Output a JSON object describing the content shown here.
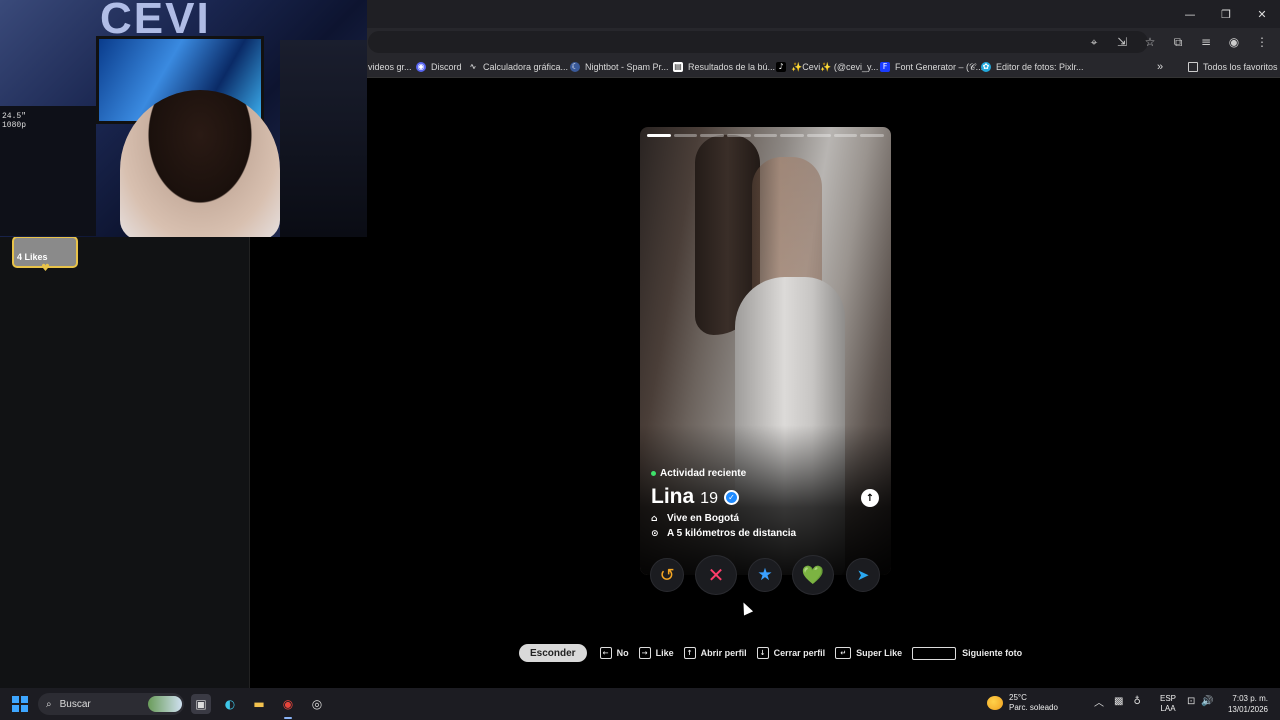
{
  "window": {
    "controls": [
      "—",
      "❐",
      "✕"
    ]
  },
  "toolbar": {
    "icons": [
      "location-icon",
      "install-icon",
      "star-icon",
      "extensions-icon",
      "media-icon",
      "profile-icon",
      "menu-icon"
    ]
  },
  "bookmarks": [
    {
      "label": "videos gr...",
      "icon": "video-icon",
      "color": "#27272c"
    },
    {
      "label": "Discord",
      "icon": "discord-icon",
      "color": "#5865f2"
    },
    {
      "label": "Calculadora gráfica...",
      "icon": "desmos-icon",
      "color": "#2d2d2d"
    },
    {
      "label": "Nightbot - Spam Pr...",
      "icon": "nightbot-icon",
      "color": "#3a5a9a"
    },
    {
      "label": "Resultados de la bú...",
      "icon": "doc-icon",
      "color": "#ffffff"
    },
    {
      "label": "✨Cevi✨ (@cevi_y...",
      "icon": "tiktok-icon",
      "color": "#000000"
    },
    {
      "label": "Font Generator – (𝒞...",
      "icon": "font-icon",
      "color": "#1a3cff"
    },
    {
      "label": "Editor de fotos: Pixlr...",
      "icon": "pixlr-icon",
      "color": "#22aadd"
    }
  ],
  "bookmarks_more": "»",
  "bookmarks_all": "Todos los favoritos",
  "webcam": {
    "logo": "CEVI",
    "monitor_text": "24.5\"\n1080p"
  },
  "sidebar": {
    "likes_label": "4 Likes"
  },
  "profile": {
    "photo_count": 9,
    "current_photo": 1,
    "activity": "Actividad reciente",
    "name": "Lina",
    "age": "19",
    "lives_in": "Vive en Bogotá",
    "distance": "A 5 kilómetros de distancia"
  },
  "actions": {
    "rewind": "↺",
    "nope": "✕",
    "super_like": "★",
    "like": "💚",
    "boost": "➤",
    "colors": {
      "rewind": "#f5a623",
      "nope": "#ff3d6b",
      "super_like": "#3aa0ff",
      "like": "#4be07a",
      "boost": "#2aa8f0"
    }
  },
  "hints": {
    "hide_label": "Esconder",
    "no": "No",
    "like": "Like",
    "open_profile": "Abrir perfil",
    "close_profile": "Cerrar perfil",
    "super_like": "Super Like",
    "next_photo": "Siguiente foto"
  },
  "taskbar": {
    "search_placeholder": "Buscar",
    "weather_temp": "25°C",
    "weather_desc": "Parc. soleado",
    "lang_line1": "ESP",
    "lang_line2": "LAA",
    "time": "7:03 p. m.",
    "date": "13/01/2026"
  }
}
